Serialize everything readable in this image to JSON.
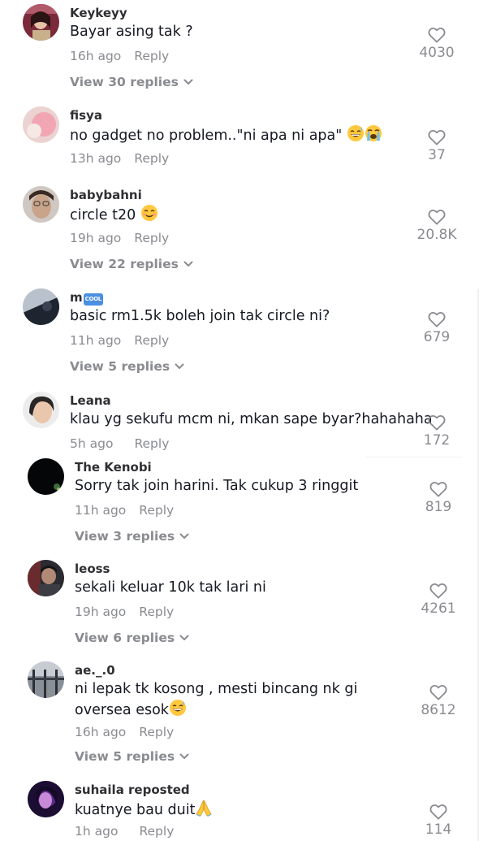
{
  "comments": [
    {
      "username": "Keykeyy",
      "text": "Bayar asing tak ?",
      "time": "16h ago",
      "reply_label": "Reply",
      "likes": "4030",
      "view_replies": "View 30 replies"
    },
    {
      "username": "fisya",
      "text": "no gadget no problem..\"ni apa ni apa\"",
      "time": "13h ago",
      "reply_label": "Reply",
      "likes": "37",
      "emojis": [
        "grinning-sweat-emoji",
        "loudly-crying-emoji"
      ]
    },
    {
      "username": "babybahni",
      "text": "circle t20",
      "time": "19h ago",
      "reply_label": "Reply",
      "likes": "20.8K",
      "view_replies": "View 22 replies",
      "emojis": [
        "smiling-blush-emoji"
      ]
    },
    {
      "username": "m",
      "badge": "COOL",
      "text": "basic rm1.5k boleh join tak circle ni?",
      "time": "11h ago",
      "reply_label": "Reply",
      "likes": "679",
      "view_replies": "View 5 replies"
    },
    {
      "username": "Leana",
      "text": "klau yg sekufu mcm ni, mkan sape byar?hahahaha",
      "time": "5h ago",
      "reply_label": "Reply",
      "likes": "172"
    },
    {
      "username": "The Kenobi",
      "text": "Sorry tak join harini. Tak cukup 3 ringgit",
      "time": "11h ago",
      "reply_label": "Reply",
      "likes": "819",
      "view_replies": "View 3 replies"
    },
    {
      "username": "leoss",
      "text": "sekali keluar 10k tak lari ni",
      "time": "19h ago",
      "reply_label": "Reply",
      "likes": "4261",
      "view_replies": "View 6 replies"
    },
    {
      "username": "ae._.0",
      "text": "ni lepak tk kosong , mesti bincang nk gi oversea esok",
      "time": "16h ago",
      "reply_label": "Reply",
      "likes": "8612",
      "view_replies": "View 5 replies",
      "emojis": [
        "grinning-sweat-emoji"
      ]
    },
    {
      "username": "suhaila reposted",
      "text": "kuatnye bau duit",
      "time": "1h ago",
      "reply_label": "Reply",
      "likes": "114",
      "emojis": [
        "folded-hands-emoji"
      ]
    }
  ],
  "icons": {
    "like": "heart-outline-icon",
    "expand": "chevron-down-icon"
  },
  "colors": {
    "text": "#161823",
    "muted": "#8a8b91",
    "username": "#2f2f33",
    "badge": "#4b8fe0"
  }
}
